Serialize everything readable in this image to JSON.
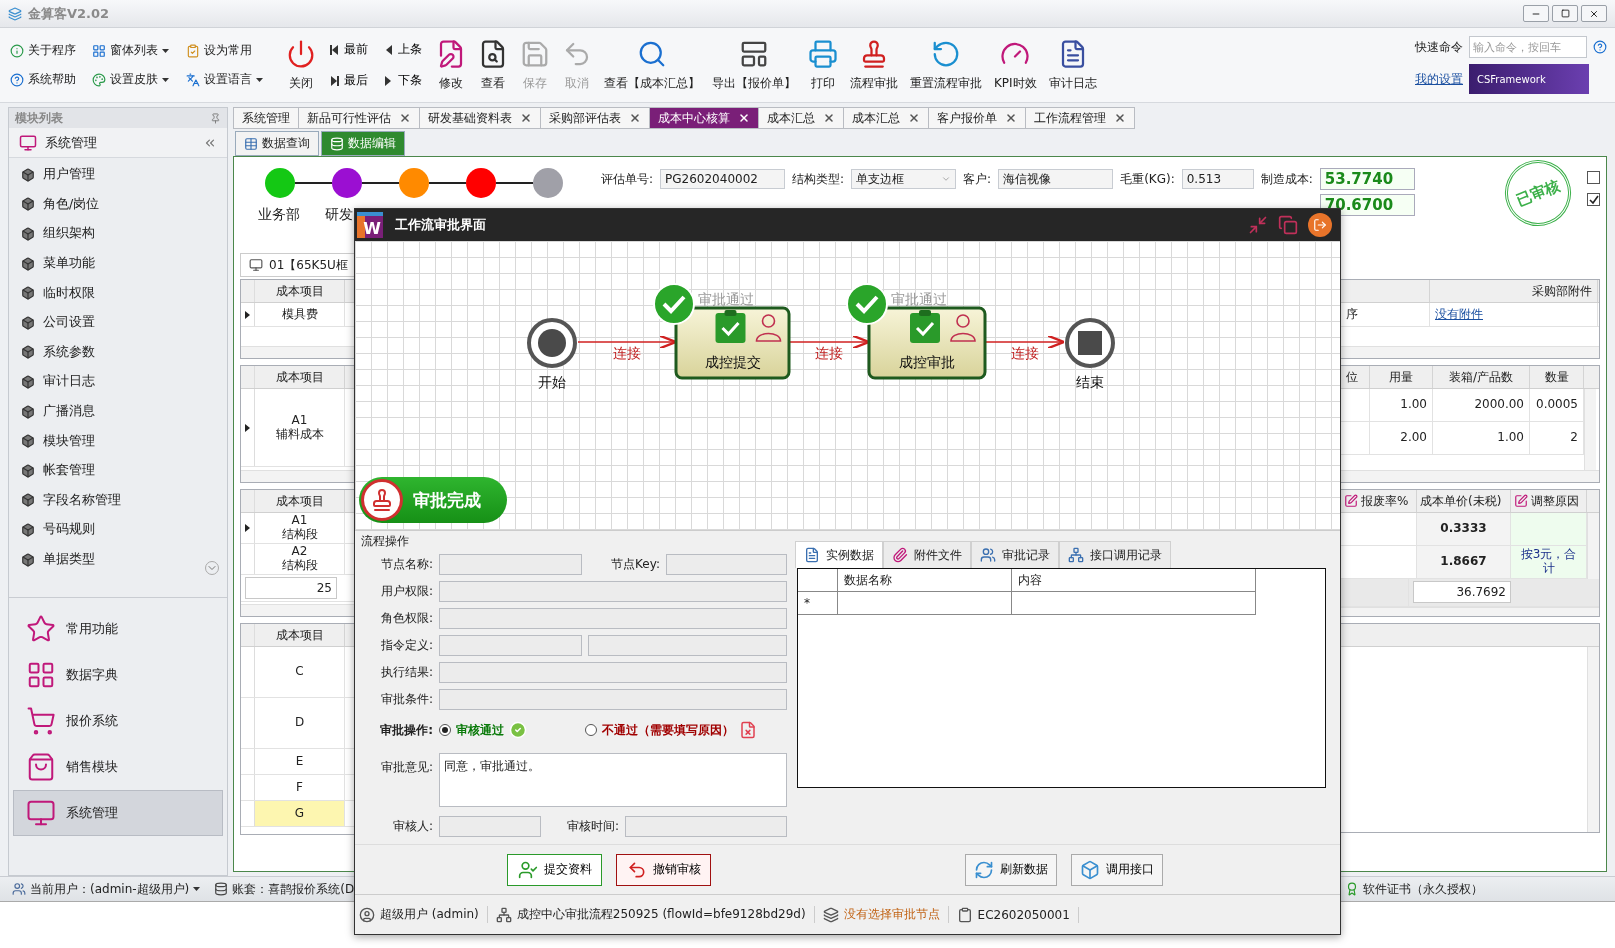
{
  "app": {
    "title": "金算客V2.02"
  },
  "toolbar": {
    "quick": [
      {
        "label": "关于程序",
        "dropdown": false
      },
      {
        "label": "窗体列表",
        "dropdown": true
      },
      {
        "label": "设为常用",
        "dropdown": false
      },
      {
        "label": "系统帮助",
        "dropdown": false
      },
      {
        "label": "设置皮肤",
        "dropdown": true
      },
      {
        "label": "设置语言",
        "dropdown": true
      }
    ],
    "buttons": [
      {
        "kind": "large",
        "label": "关闭",
        "disabled": false
      },
      {
        "kind": "pair",
        "top": "最前",
        "bottom": "最后"
      },
      {
        "kind": "pair",
        "top": "上条",
        "bottom": "下条"
      },
      {
        "kind": "large",
        "label": "修改",
        "disabled": false
      },
      {
        "kind": "large",
        "label": "查看",
        "disabled": false
      },
      {
        "kind": "large",
        "label": "保存",
        "disabled": true
      },
      {
        "kind": "large",
        "label": "取消",
        "disabled": true
      },
      {
        "kind": "large",
        "label": "查看【成本汇总】",
        "disabled": false
      },
      {
        "kind": "large",
        "label": "导出【报价单】",
        "disabled": false
      },
      {
        "kind": "large",
        "label": "打印",
        "disabled": false
      },
      {
        "kind": "large",
        "label": "流程审批",
        "disabled": false
      },
      {
        "kind": "large",
        "label": "重置流程审批",
        "disabled": false
      },
      {
        "kind": "large",
        "label": "KPI时效",
        "disabled": false
      },
      {
        "kind": "large",
        "label": "审计日志",
        "disabled": false
      }
    ],
    "command": {
      "label": "快速命令",
      "placeholder": "输入命令，按回车"
    },
    "settings_link": "我的设置",
    "banner": "CSFramework"
  },
  "sidebar": {
    "title": "模块列表",
    "group": "系统管理",
    "items": [
      "用户管理",
      "角色/岗位",
      "组织架构",
      "菜单功能",
      "临时权限",
      "公司设置",
      "系统参数",
      "审计日志",
      "广播消息",
      "模块管理",
      "帐套管理",
      "字段名称管理",
      "号码规则",
      "单据类型"
    ],
    "nav": [
      {
        "label": "常用功能",
        "selected": false
      },
      {
        "label": "数据字典",
        "selected": false
      },
      {
        "label": "报价系统",
        "selected": false
      },
      {
        "label": "销售模块",
        "selected": false
      },
      {
        "label": "系统管理",
        "selected": true
      }
    ]
  },
  "tabs": [
    {
      "label": "系统管理",
      "closable": false,
      "selected": false
    },
    {
      "label": "新品可行性评估",
      "closable": true,
      "selected": false
    },
    {
      "label": "研发基础资料表",
      "closable": true,
      "selected": false
    },
    {
      "label": "采购部评估表",
      "closable": true,
      "selected": false
    },
    {
      "label": "成本中心核算",
      "closable": true,
      "selected": true
    },
    {
      "label": "成本汇总",
      "closable": true,
      "selected": false
    },
    {
      "label": "成本汇总",
      "closable": true,
      "selected": false
    },
    {
      "label": "客户报价单",
      "closable": true,
      "selected": false
    },
    {
      "label": "工作流程管理",
      "closable": true,
      "selected": false
    }
  ],
  "subtabs": [
    {
      "label": "数据查询",
      "selected": false
    },
    {
      "label": "数据编辑",
      "selected": true
    }
  ],
  "stages": [
    {
      "label": "业务部",
      "color": "#14c814"
    },
    {
      "label": "研发",
      "color": "#9b0fd2"
    },
    {
      "color": "#ff8a00"
    },
    {
      "color": "#ff0000"
    },
    {
      "color": "#a0a0a8"
    }
  ],
  "fields": [
    {
      "label": "评估单号:",
      "value": "PG2602040002",
      "kind": "text"
    },
    {
      "label": "结构类型:",
      "value": "单支边框",
      "kind": "select"
    },
    {
      "label": "客户:",
      "value": "海信视像",
      "kind": "text"
    },
    {
      "label": "毛重(KG):",
      "value": "0.513",
      "kind": "text"
    },
    {
      "label": "制造成本:",
      "value": "53.7740",
      "kind": "total"
    },
    {
      "value": "70.6700",
      "kind": "total"
    }
  ],
  "stamp": "已审核",
  "checkboxes": [
    {
      "checked": false
    },
    {
      "checked": true
    }
  ],
  "record_tab": "01【65K5U框",
  "left_grids": [
    {
      "header": "成本项目",
      "rows": [
        {
          "text": "模具费",
          "current": true
        }
      ]
    },
    {
      "header": "成本项目",
      "rows": [
        {
          "text": "A1\n辅料成本",
          "current": true
        }
      ]
    },
    {
      "header": "成本项目",
      "rows": [
        {
          "text": "A1\n结构段",
          "current": true
        },
        {
          "text": "A2\n结构段",
          "current": false
        }
      ],
      "footer": "25"
    },
    {
      "header": "成本项目",
      "rows": [
        {
          "text": "C",
          "highlighted": false
        },
        {
          "text": "D",
          "highlighted": false
        },
        {
          "text": "E",
          "highlighted": false
        },
        {
          "text": "F",
          "highlighted": false
        },
        {
          "text": "G",
          "highlighted": true
        }
      ]
    }
  ],
  "right_grids": {
    "attachments": {
      "header": "采购部附件",
      "step": "序",
      "link": "没有附件"
    },
    "usage": {
      "columns": [
        "位",
        "用量",
        "装箱/产品数",
        "数量"
      ],
      "rows": [
        [
          "1.00",
          "2000.00",
          "0.0005"
        ],
        [
          "2.00",
          "1.00",
          "2"
        ]
      ]
    },
    "cost": {
      "columns": [
        {
          "label": "报废率%",
          "editable": true
        },
        {
          "label": "成本单价(未税)",
          "editable": false
        },
        {
          "label": "调整原因",
          "editable": true
        }
      ],
      "rows": [
        {
          "price": "0.3333"
        },
        {
          "price": "1.8667",
          "reason": "按3元，合计"
        }
      ],
      "total": "36.7692"
    }
  },
  "dialog": {
    "logo": "W",
    "title": "工作流审批界面",
    "diagram": {
      "nodes": [
        {
          "kind": "start",
          "label": "开始"
        },
        {
          "kind": "task",
          "label": "成控提交",
          "status": "审批通过",
          "approved": true
        },
        {
          "kind": "task",
          "label": "成控审批",
          "status": "审批通过",
          "approved": true
        },
        {
          "kind": "end",
          "label": "结束"
        }
      ],
      "edges": [
        "连接",
        "连接",
        "连接"
      ],
      "result": "审批完成"
    },
    "form": {
      "title": "流程操作",
      "rows": [
        {
          "kind": "pair",
          "label": "节点名称:",
          "label2": "节点Key:"
        },
        {
          "kind": "single",
          "label": "用户权限:"
        },
        {
          "kind": "single",
          "label": "角色权限:"
        },
        {
          "kind": "double",
          "label": "指令定义:"
        },
        {
          "kind": "single",
          "label": "执行结果:"
        },
        {
          "kind": "single",
          "label": "审批条件:"
        },
        {
          "kind": "radios",
          "label": "审批操作:",
          "options": [
            {
              "label": "审核通过",
              "selected": true,
              "color": "#0a7a0a"
            },
            {
              "label": "不通过（需要填写原因）",
              "selected": false,
              "color": "#a00000"
            }
          ]
        },
        {
          "kind": "memo",
          "label": "审批意见:",
          "value": "同意，审批通过。"
        },
        {
          "kind": "pair",
          "label": "审核人:",
          "label2": "审核时间:"
        }
      ]
    },
    "tabs": [
      {
        "label": "实例数据",
        "selected": true
      },
      {
        "label": "附件文件",
        "selected": false
      },
      {
        "label": "审批记录",
        "selected": false
      },
      {
        "label": "接口调用记录",
        "selected": false
      }
    ],
    "grid": {
      "columns": [
        "数据名称",
        "内容"
      ],
      "new_row": "*"
    },
    "buttons": [
      {
        "kind": "submit",
        "label": "提交资料"
      },
      {
        "kind": "revoke",
        "label": "撤销审核"
      },
      {
        "kind": "refresh",
        "label": "刷新数据"
      },
      {
        "kind": "api",
        "label": "调用接口"
      }
    ],
    "status": [
      {
        "kind": "user",
        "text": "超级用户 (admin)"
      },
      {
        "kind": "flow",
        "text": "成控中心审批流程250925 (flowId=bfe9128bd29d)"
      },
      {
        "kind": "warning",
        "text": "没有选择审批节点"
      },
      {
        "kind": "doc",
        "text": "EC2602050001"
      }
    ]
  },
  "status_bar": {
    "user": "当前用户：(admin-超级用户)",
    "account": "账套：喜鹊报价系统(D",
    "license": "软件证书（永久授权）"
  }
}
